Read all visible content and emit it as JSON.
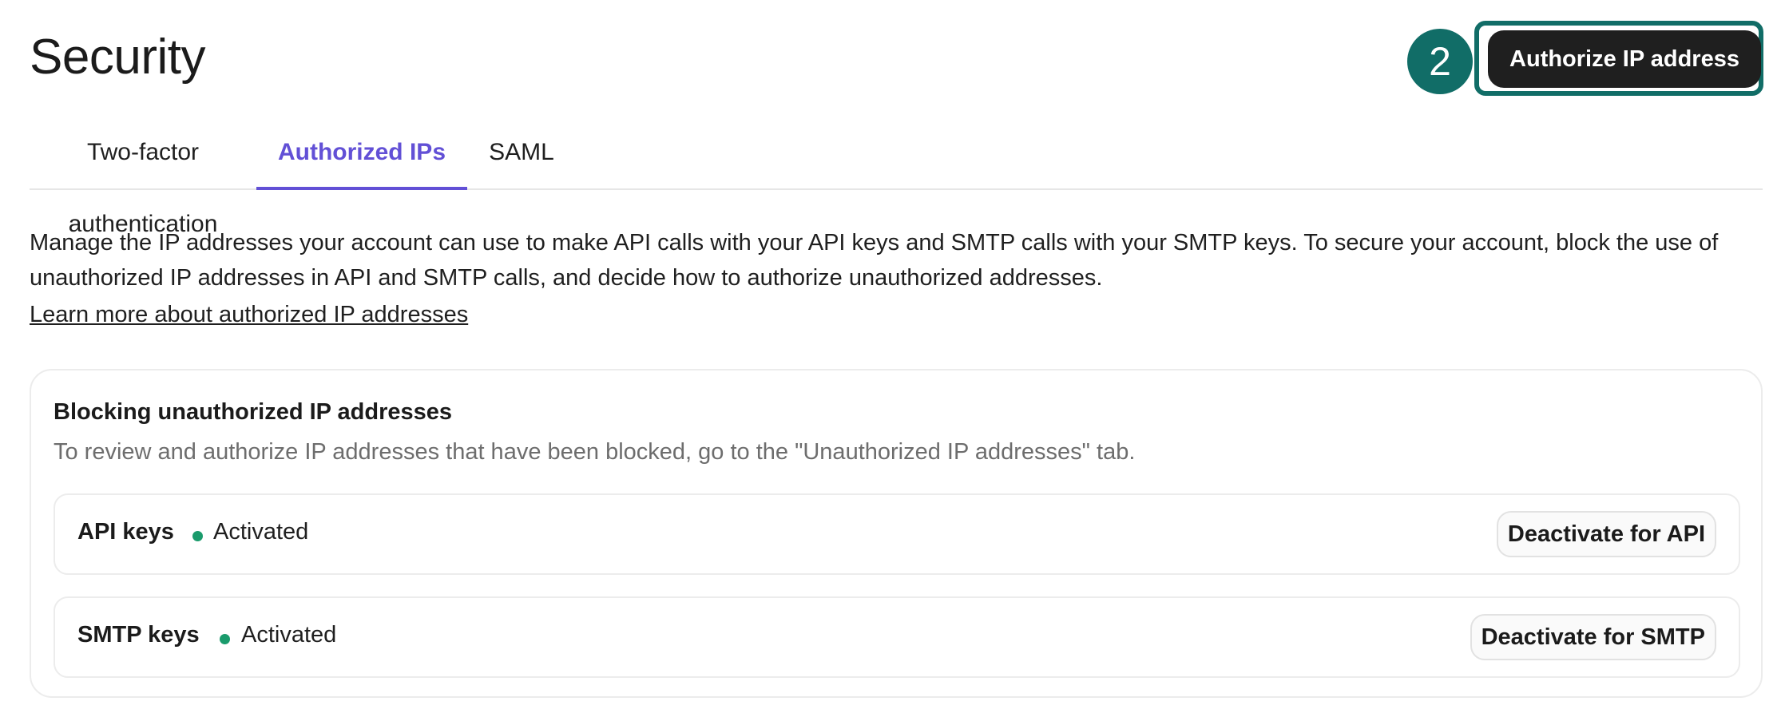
{
  "header": {
    "title": "Security",
    "step_number": "2",
    "authorize_button_label": "Authorize IP address"
  },
  "tabs": [
    {
      "label": "Two-factor authentication",
      "active": false
    },
    {
      "label": "Authorized IPs",
      "active": true
    },
    {
      "label": "SAML",
      "active": false
    }
  ],
  "main": {
    "description": "Manage the IP addresses your account can use to make API calls with your API keys and SMTP calls with your SMTP keys. To secure your account, block the use of unauthorized IP addresses in API and SMTP calls, and decide how to authorize unauthorized addresses.",
    "learn_more_link": "Learn more about authorized IP addresses"
  },
  "blocking_card": {
    "title": "Blocking unauthorized IP addresses",
    "subtitle": "To review and authorize IP addresses that have been blocked, go to the \"Unauthorized IP addresses\" tab.",
    "rows": [
      {
        "label": "API keys",
        "status": "Activated",
        "status_color": "#1a9b6c",
        "button_label": "Deactivate for API"
      },
      {
        "label": "SMTP keys",
        "status": "Activated",
        "status_color": "#1a9b6c",
        "button_label": "Deactivate for SMTP"
      }
    ]
  },
  "colors": {
    "accent": "#6250d6",
    "highlight": "#116d67",
    "primary_button": "#1f1f1f",
    "status_active": "#1a9b6c"
  }
}
